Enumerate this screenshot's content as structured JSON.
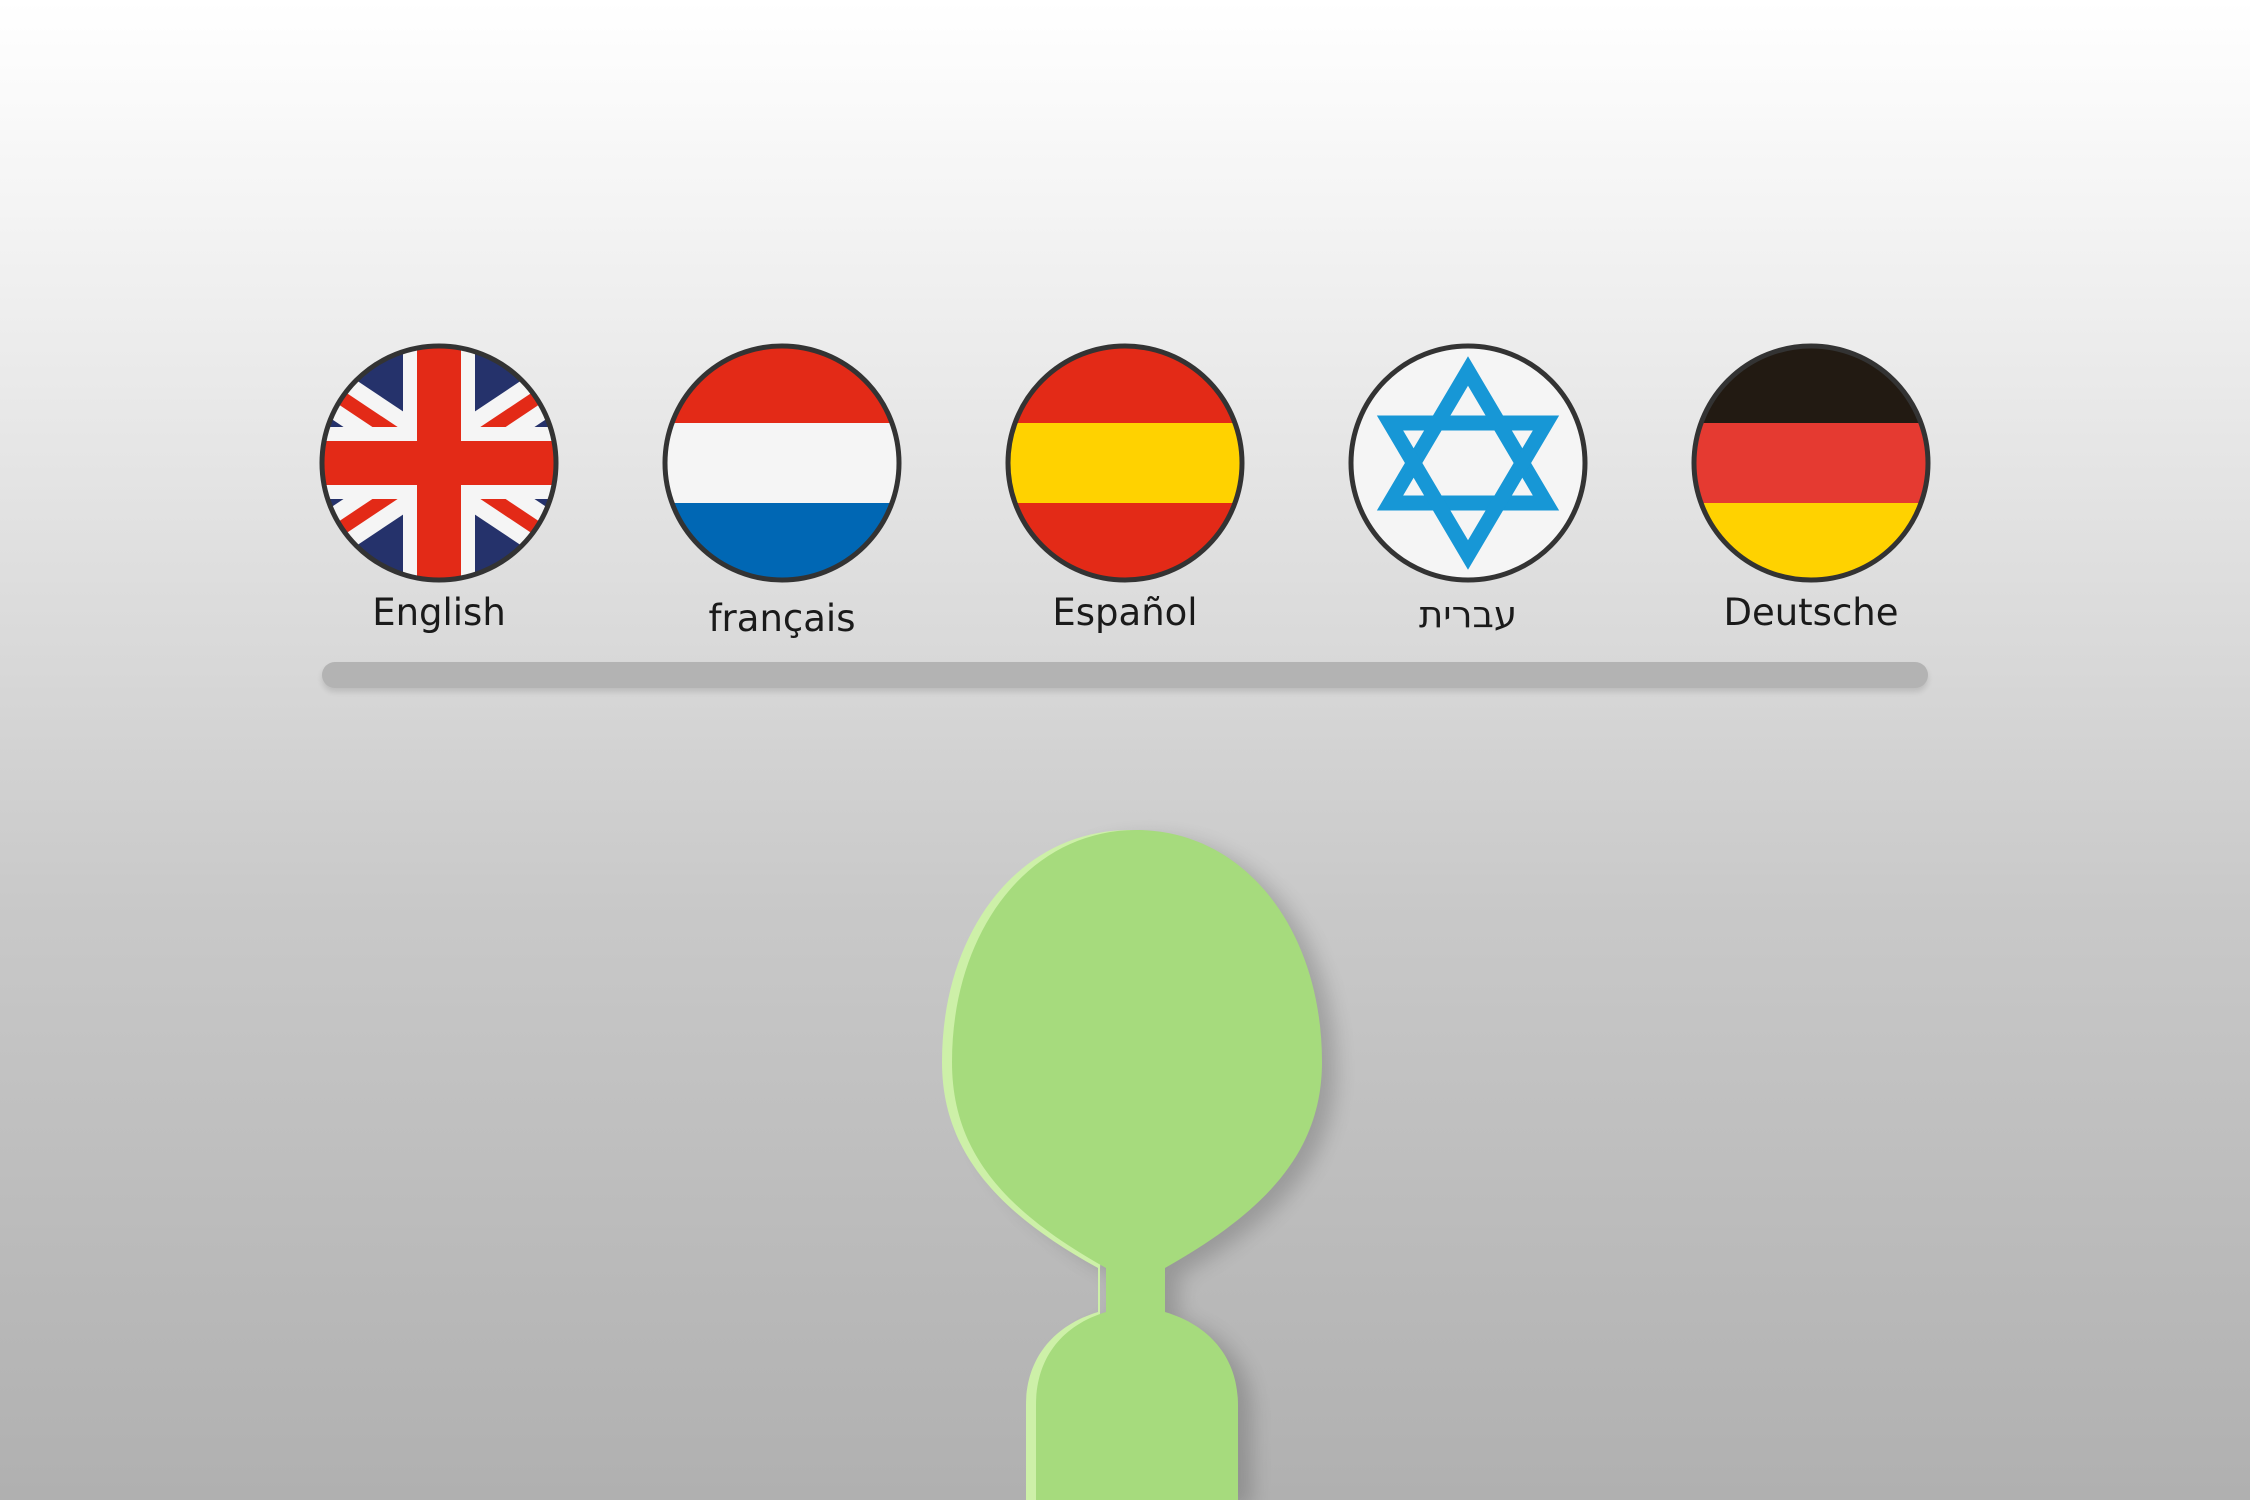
{
  "languages": [
    {
      "label": "English",
      "flag": "united-kingdom-flag-icon"
    },
    {
      "label": "français",
      "flag": "netherlands-flag-icon"
    },
    {
      "label": "Español",
      "flag": "spain-flag-icon"
    },
    {
      "label": "עברית",
      "flag": "israel-flag-icon"
    },
    {
      "label": "Deutsche",
      "flag": "germany-flag-icon"
    }
  ],
  "colors": {
    "flag_red": "#e32a17",
    "flag_blue": "#0067b4",
    "flag_white": "#f5f5f5",
    "flag_yellow": "#ffd200",
    "uk_navy": "#25326b",
    "israel_blue": "#1797d6",
    "germany_black": "#221a12",
    "germany_red": "#e53a31",
    "figure_green": "#a6db7d",
    "figure_highlight": "#cdf0a8",
    "track_gray": "#b3b3b3",
    "flag_outline": "#333333"
  }
}
